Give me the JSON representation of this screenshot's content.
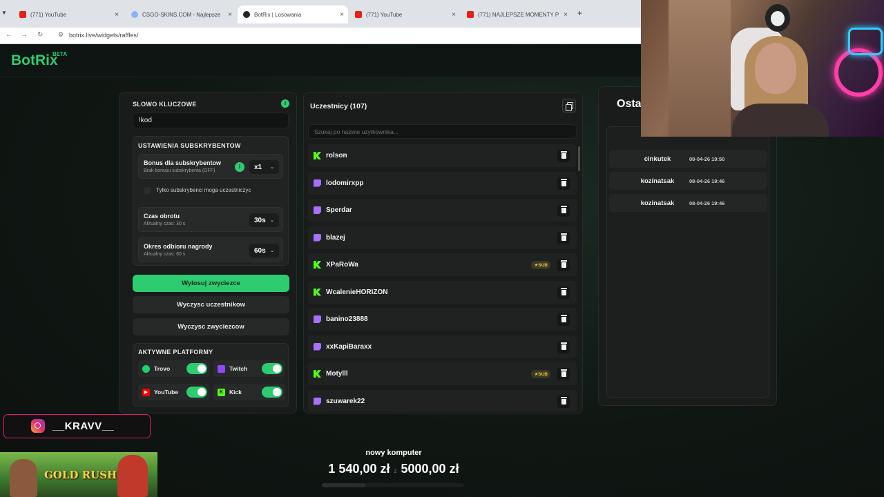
{
  "browser": {
    "tabs": [
      {
        "label": "(771) YouTube",
        "color": "#e62117"
      },
      {
        "label": "CSGO-SKINS.COM - Najlepsze",
        "color": "#8ab4f8"
      },
      {
        "label": "BotRix | Losowania",
        "color": "#222222"
      },
      {
        "label": "(771) YouTube",
        "color": "#e62117"
      },
      {
        "label": "(771) NAJLEPSZE MOMENTY P",
        "color": "#e62117"
      }
    ],
    "url": "botrix.live/widgets/raffles/"
  },
  "brand": {
    "name": "BotRix",
    "badge": "BETA",
    "accent": "#2ecc71"
  },
  "keyword": {
    "title": "SLOWO KLUCZOWE",
    "info_icon": "i",
    "value": "!kod"
  },
  "sub_settings": {
    "title": "USTAWIENIA SUBSKRYBENTOW",
    "bonus": {
      "label": "Bonus dla subskrybentow",
      "sub": "Brak bonusu subskrybenta (OFF)",
      "info_icon": "i",
      "value": "x1"
    },
    "only_subs": "Tylko subskrybenci moga uczestniczyc",
    "spin_time": {
      "label": "Czas obrotu",
      "sub": "Aktualny czas: 30 s",
      "value": "30s"
    },
    "claim_time": {
      "label": "Okres odbioru nagrody",
      "sub": "Aktualny czas: 60 s",
      "value": "60s"
    }
  },
  "actions": {
    "draw": "Wylosuj zwyciezce",
    "clear_participants": "Wyczysc uczestnikow",
    "clear_winners": "Wyczysc zwyciezcow"
  },
  "platforms": {
    "title": "AKTYWNE PLATFORMY",
    "items": [
      {
        "name": "Trovo",
        "color": "#19d66b",
        "enabled": true
      },
      {
        "name": "Twitch",
        "color": "#9146ff",
        "enabled": true
      },
      {
        "name": "YouTube",
        "color": "#ff0000",
        "enabled": true
      },
      {
        "name": "Kick",
        "color": "#53fc18",
        "enabled": true
      }
    ]
  },
  "participants": {
    "title": "Uczestnicy (107)",
    "search_placeholder": "Szukaj po nazwie uzytkownika...",
    "sub_badge": "SUB",
    "list": [
      {
        "name": "rolson",
        "platform": "kick",
        "sub": false
      },
      {
        "name": "lodomirxpp",
        "platform": "twitch",
        "sub": false
      },
      {
        "name": "Sperdar",
        "platform": "twitch",
        "sub": false
      },
      {
        "name": "blazej",
        "platform": "twitch",
        "sub": false
      },
      {
        "name": "XPaRoWa",
        "platform": "kick",
        "sub": true
      },
      {
        "name": "WcalenieHORIZON",
        "platform": "kick",
        "sub": false
      },
      {
        "name": "banino23888",
        "platform": "twitch",
        "sub": false
      },
      {
        "name": "xxKapiBaraxx",
        "platform": "twitch",
        "sub": false
      },
      {
        "name": "Motylll",
        "platform": "kick",
        "sub": true
      },
      {
        "name": "szuwarek22",
        "platform": "twitch",
        "sub": false
      }
    ]
  },
  "winners": {
    "heading": "Osta",
    "list": [
      {
        "name": "cinkutek",
        "date": "08-04-26 19:50"
      },
      {
        "name": "kozinatsak",
        "date": "08-04-26 19:46"
      },
      {
        "name": "kozinatsak",
        "date": "08-04-26 19:46"
      }
    ]
  },
  "overlay": {
    "instagram": "__KRAVV__",
    "game_title": "GOLD RUSH",
    "goal": {
      "title": "nowy komputer",
      "current": "1 540,00 zł",
      "separator": "z",
      "target": "5000,00 zł",
      "progress_pct": 30.8
    }
  }
}
